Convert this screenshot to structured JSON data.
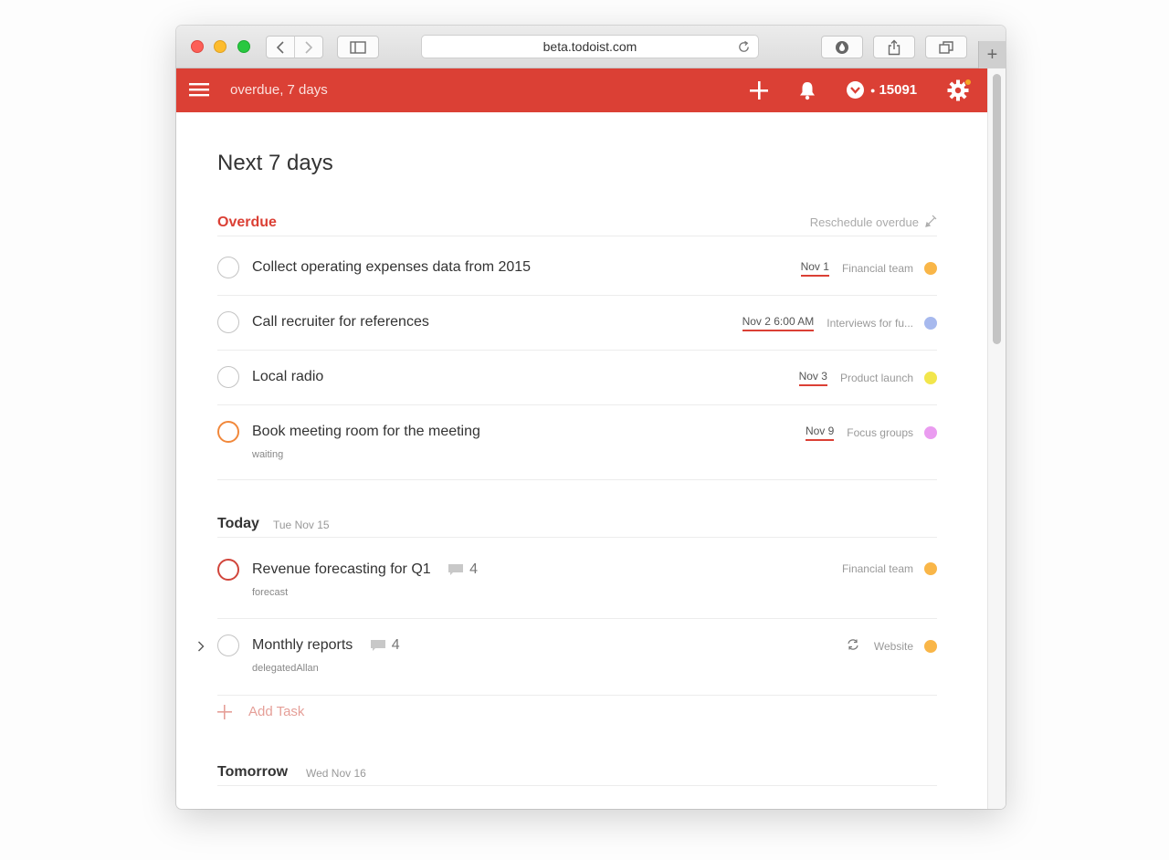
{
  "browser": {
    "url": "beta.todoist.com"
  },
  "header": {
    "search_text": "overdue, 7 days",
    "karma": "15091"
  },
  "page": {
    "title": "Next 7 days"
  },
  "sections": {
    "overdue": {
      "title": "Overdue",
      "reschedule": "Reschedule overdue"
    },
    "today": {
      "title": "Today",
      "date": "Tue Nov 15"
    },
    "tomorrow": {
      "title": "Tomorrow",
      "date": "Wed Nov 16"
    }
  },
  "overdue_tasks": [
    {
      "text": "Collect operating expenses data from 2015",
      "date": "Nov 1",
      "project": "Financial team",
      "project_color": "#f9b648",
      "priority": "none"
    },
    {
      "text": "Call recruiter for references",
      "date": "Nov 2 6:00 AM",
      "project": "Interviews for fu...",
      "project_color": "#a7b9ee",
      "priority": "none"
    },
    {
      "text": "Local radio",
      "date": "Nov 3",
      "project": "Product launch",
      "project_color": "#f2e64c",
      "priority": "none"
    },
    {
      "text": "Book meeting room for the meeting",
      "label": "waiting",
      "date": "Nov 9",
      "project": "Focus groups",
      "project_color": "#ea9cf0",
      "priority": "p2"
    }
  ],
  "today_tasks": [
    {
      "text": "Revenue forecasting for Q1",
      "label": "forecast",
      "comments": "4",
      "project": "Financial team",
      "project_color": "#f9b648",
      "priority": "p1"
    },
    {
      "text": "Monthly reports",
      "label": "delegatedAllan",
      "comments": "4",
      "project": "Website",
      "project_color": "#f9b648",
      "priority": "none",
      "recurring": true
    }
  ],
  "add_task_label": "Add Task",
  "colors": {
    "brand_red": "#db4035",
    "priority1": "#d1453b",
    "priority2": "#f1883b"
  }
}
